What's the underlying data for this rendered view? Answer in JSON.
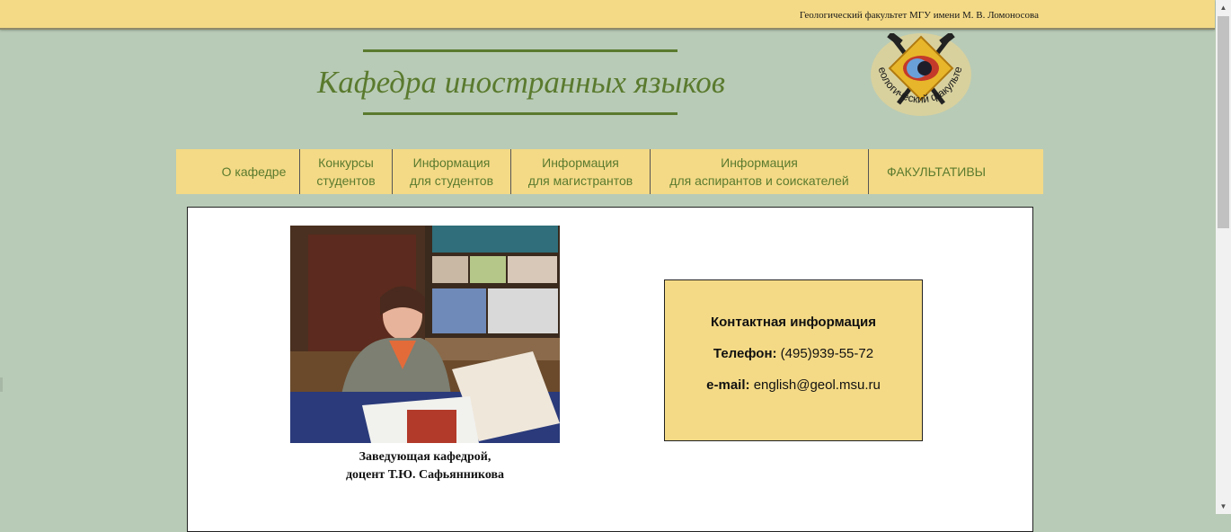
{
  "header": {
    "faculty_text": "Геологический факультет МГУ имени М. В. Ломоносова",
    "title": "Кафедра иностранных языков",
    "logo_text": "Геологический факультет",
    "logo_icon": "faculty-emblem-icon"
  },
  "nav": {
    "items": [
      {
        "label": "О кафедре"
      },
      {
        "label": "Конкурсы\nстудентов"
      },
      {
        "label": "Информация\nдля студентов"
      },
      {
        "label": "Информация\nдля магистрантов"
      },
      {
        "label": "Информация\nдля аспирантов и соискателей"
      },
      {
        "label": "ФАКУЛЬТАТИВЫ"
      }
    ]
  },
  "main": {
    "photo_caption": "Заведующая кафедрой,\nдоцент Т.Ю. Сафьянникова",
    "contact": {
      "heading": "Контактная информация",
      "phone_label": "Телефон:",
      "phone_value": "(495)939-55-72",
      "email_label": "e-mail:",
      "email_value": "english@geol.msu.ru"
    }
  },
  "colors": {
    "background": "#b8cbb6",
    "bar": "#f4da86",
    "accent": "#5a7a2e"
  }
}
